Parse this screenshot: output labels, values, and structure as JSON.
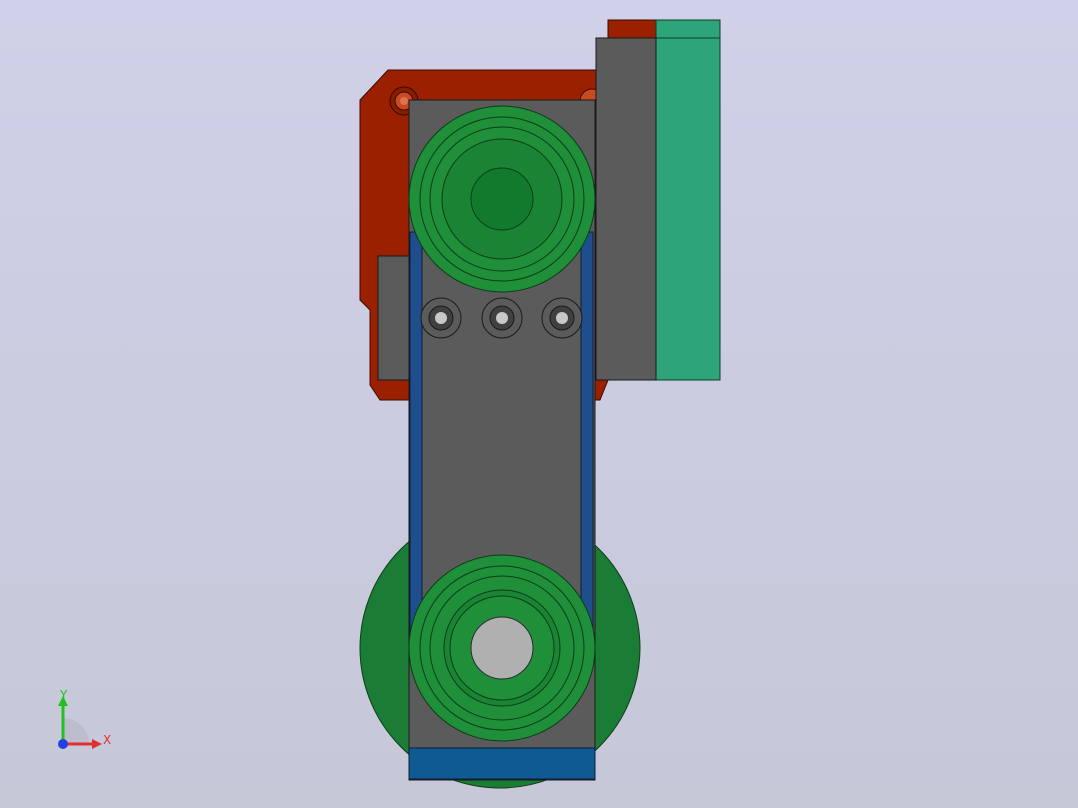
{
  "viewport": {
    "background_top": "#d0d0e8",
    "background_bottom": "#c6c8d8"
  },
  "model": {
    "colors": {
      "motor_housing": "#9a2000",
      "arm_body": "#5b5b5b",
      "arm_edge": "#1a1a1a",
      "pulley": "#1f8f3a",
      "pulley_dark": "#127a2c",
      "belt": "#1e4f8c",
      "belt_bottom": "#0f5a92",
      "rail_green": "#2ea47a",
      "base_disc": "#1b7d35",
      "bore": "#b0b0b0"
    }
  },
  "triad": {
    "x_label": "X",
    "y_label": "Y",
    "x_color": "#e03030",
    "y_color": "#20c020",
    "z_color": "#2040e0"
  }
}
